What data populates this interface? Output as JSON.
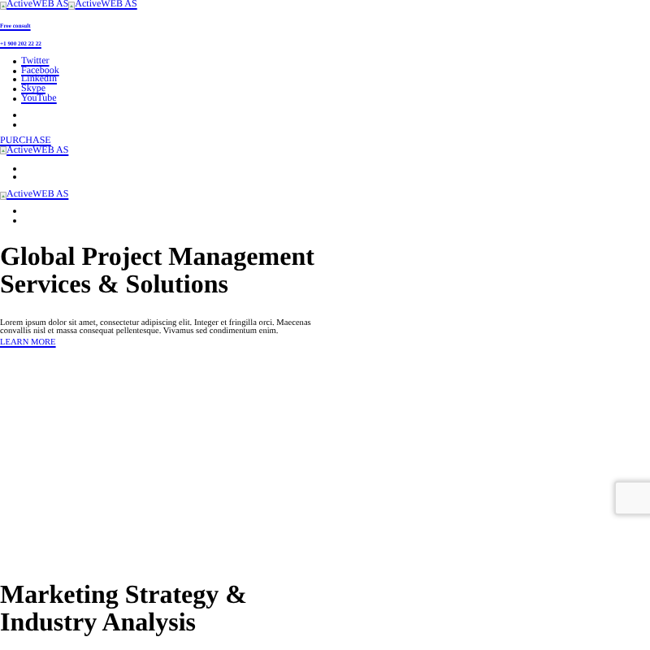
{
  "header": {
    "logos": [
      "ActiveWEB AS",
      "ActiveWEB AS"
    ],
    "consult_label": "Free consult",
    "phone": "+1 900 202 22 22",
    "social_links": [
      "Twitter",
      "Facebook",
      "LinkedIn",
      "Skype",
      "YouTube"
    ],
    "purchase_link": "PURCHASE",
    "mobile_logo": "ActiveWEB AS",
    "sticky_logo": "ActiveWEB AS"
  },
  "hero": {
    "title": "Global Project Management Services & Solutions",
    "text": "Lorem ipsum dolor sit amet, consectetur adipiscing elit. Integer et fringilla orci. Maecenas convallis nisl et massa consequat pellentesque. Vivamus sed condimentum enim.",
    "link": "LEARN MORE"
  },
  "section": {
    "title": "Marketing Strategy & Industry Analysis"
  }
}
